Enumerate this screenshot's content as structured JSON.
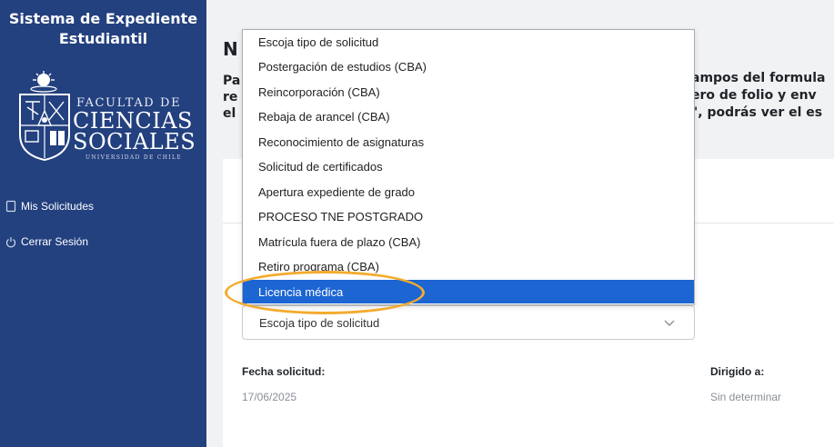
{
  "sidebar": {
    "title_line1": "Sistema de Expediente",
    "title_line2": "Estudiantil",
    "logo": {
      "line1": "FACULTAD DE",
      "line2": "CIENCIAS",
      "line3": "SOCIALES",
      "line4": "UNIVERSIDAD DE CHILE"
    },
    "nav": [
      {
        "label": "Mis Solicitudes",
        "icon": "document-icon"
      },
      {
        "label": "Cerrar Sesión",
        "icon": "power-icon"
      }
    ]
  },
  "main": {
    "title_fragment": "N",
    "intro_left": [
      "Pa",
      "re",
      "el"
    ],
    "intro_right": [
      "ampos del formula",
      "ero de folio y env",
      "\", podrás ver el es"
    ]
  },
  "form": {
    "select_value": "Escoja tipo de solicitud",
    "fecha_label": "Fecha solicitud:",
    "fecha_value": "17/06/2025",
    "dirigido_label": "Dirigido a:",
    "dirigido_value": "Sin determinar"
  },
  "dropdown": {
    "options": [
      "Escoja tipo de solicitud",
      "Postergación de estudios (CBA)",
      "Reincorporación (CBA)",
      "Rebaja de arancel (CBA)",
      "Reconocimiento de asignaturas",
      "Solicitud de certificados",
      "Apertura expediente de grado",
      "PROCESO TNE POSTGRADO",
      "Matrícula fuera de plazo (CBA)",
      "Retiro programa (CBA)",
      "Licencia médica"
    ],
    "selected_index": 10
  },
  "colors": {
    "sidebar_bg": "#23407f",
    "selected_option": "#1c65d3",
    "highlight_ring": "#f3ab2e"
  }
}
